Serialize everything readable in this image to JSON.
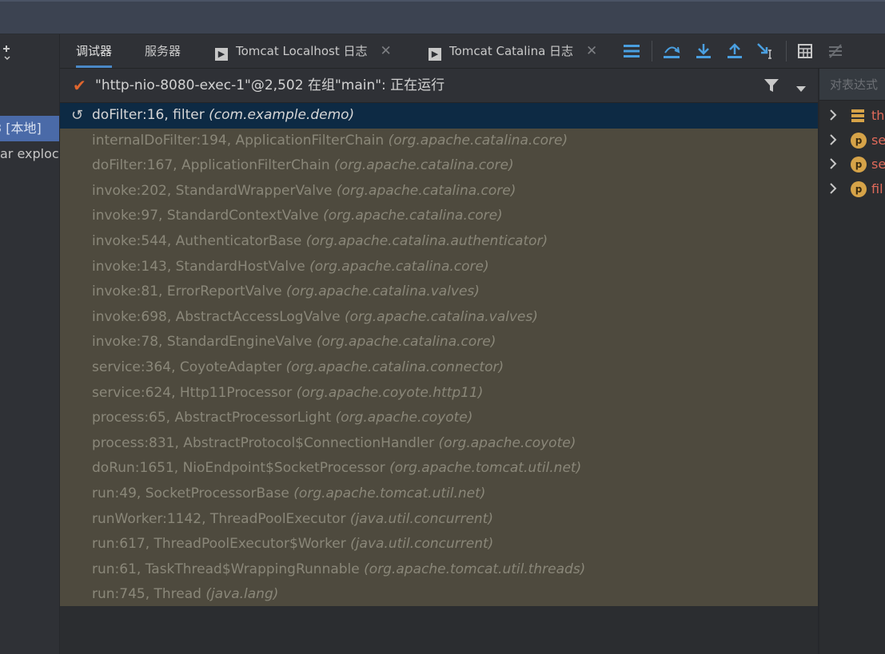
{
  "left_panel": {
    "selected_label": "3 [本地]",
    "item2_label": "ar exploc"
  },
  "tabs": [
    {
      "label": "调试器",
      "active": true
    },
    {
      "label": "服务器",
      "active": false
    },
    {
      "label": "Tomcat Localhost 日志",
      "active": false,
      "closable": true
    },
    {
      "label": "Tomcat Catalina 日志",
      "active": false,
      "closable": true
    }
  ],
  "toolbar_icons": [
    "menu-lines-icon",
    "step-over-icon",
    "step-into-icon",
    "step-out-icon",
    "run-to-cursor-icon",
    "evaluate-table-icon",
    "disabled-icon"
  ],
  "thread": {
    "title": "\"http-nio-8080-exec-1\"@2,502 在组\"main\": 正在运行"
  },
  "frames": [
    {
      "loc": "doFilter:16, filter",
      "pkg": "(com.example.demo)",
      "current": true
    },
    {
      "loc": "internalDoFilter:194, ApplicationFilterChain",
      "pkg": "(org.apache.catalina.core)"
    },
    {
      "loc": "doFilter:167, ApplicationFilterChain",
      "pkg": "(org.apache.catalina.core)"
    },
    {
      "loc": "invoke:202, StandardWrapperValve",
      "pkg": "(org.apache.catalina.core)"
    },
    {
      "loc": "invoke:97, StandardContextValve",
      "pkg": "(org.apache.catalina.core)"
    },
    {
      "loc": "invoke:544, AuthenticatorBase",
      "pkg": "(org.apache.catalina.authenticator)"
    },
    {
      "loc": "invoke:143, StandardHostValve",
      "pkg": "(org.apache.catalina.core)"
    },
    {
      "loc": "invoke:81, ErrorReportValve",
      "pkg": "(org.apache.catalina.valves)"
    },
    {
      "loc": "invoke:698, AbstractAccessLogValve",
      "pkg": "(org.apache.catalina.valves)"
    },
    {
      "loc": "invoke:78, StandardEngineValve",
      "pkg": "(org.apache.catalina.core)"
    },
    {
      "loc": "service:364, CoyoteAdapter",
      "pkg": "(org.apache.catalina.connector)"
    },
    {
      "loc": "service:624, Http11Processor",
      "pkg": "(org.apache.coyote.http11)"
    },
    {
      "loc": "process:65, AbstractProcessorLight",
      "pkg": "(org.apache.coyote)"
    },
    {
      "loc": "process:831, AbstractProtocol$ConnectionHandler",
      "pkg": "(org.apache.coyote)"
    },
    {
      "loc": "doRun:1651, NioEndpoint$SocketProcessor",
      "pkg": "(org.apache.tomcat.util.net)"
    },
    {
      "loc": "run:49, SocketProcessorBase",
      "pkg": "(org.apache.tomcat.util.net)"
    },
    {
      "loc": "runWorker:1142, ThreadPoolExecutor",
      "pkg": "(java.util.concurrent)"
    },
    {
      "loc": "run:617, ThreadPoolExecutor$Worker",
      "pkg": "(java.util.concurrent)"
    },
    {
      "loc": "run:61, TaskThread$WrappingRunnable",
      "pkg": "(org.apache.tomcat.util.threads)"
    },
    {
      "loc": "run:745, Thread",
      "pkg": "(java.lang)"
    }
  ],
  "variables": {
    "expression_placeholder": "对表达式",
    "items": [
      {
        "name": "th",
        "icon": "stack-icon"
      },
      {
        "name": "se",
        "icon": "p-badge-icon",
        "badge": "p"
      },
      {
        "name": "se",
        "icon": "p-badge-icon",
        "badge": "p"
      },
      {
        "name": "fil",
        "icon": "p-badge-icon",
        "badge": "p"
      }
    ]
  },
  "colors": {
    "accent": "#4a88c7",
    "current_frame": "#0d2a44",
    "frames_bg": "#4e4a3e",
    "var_name": "#e06a5a"
  }
}
